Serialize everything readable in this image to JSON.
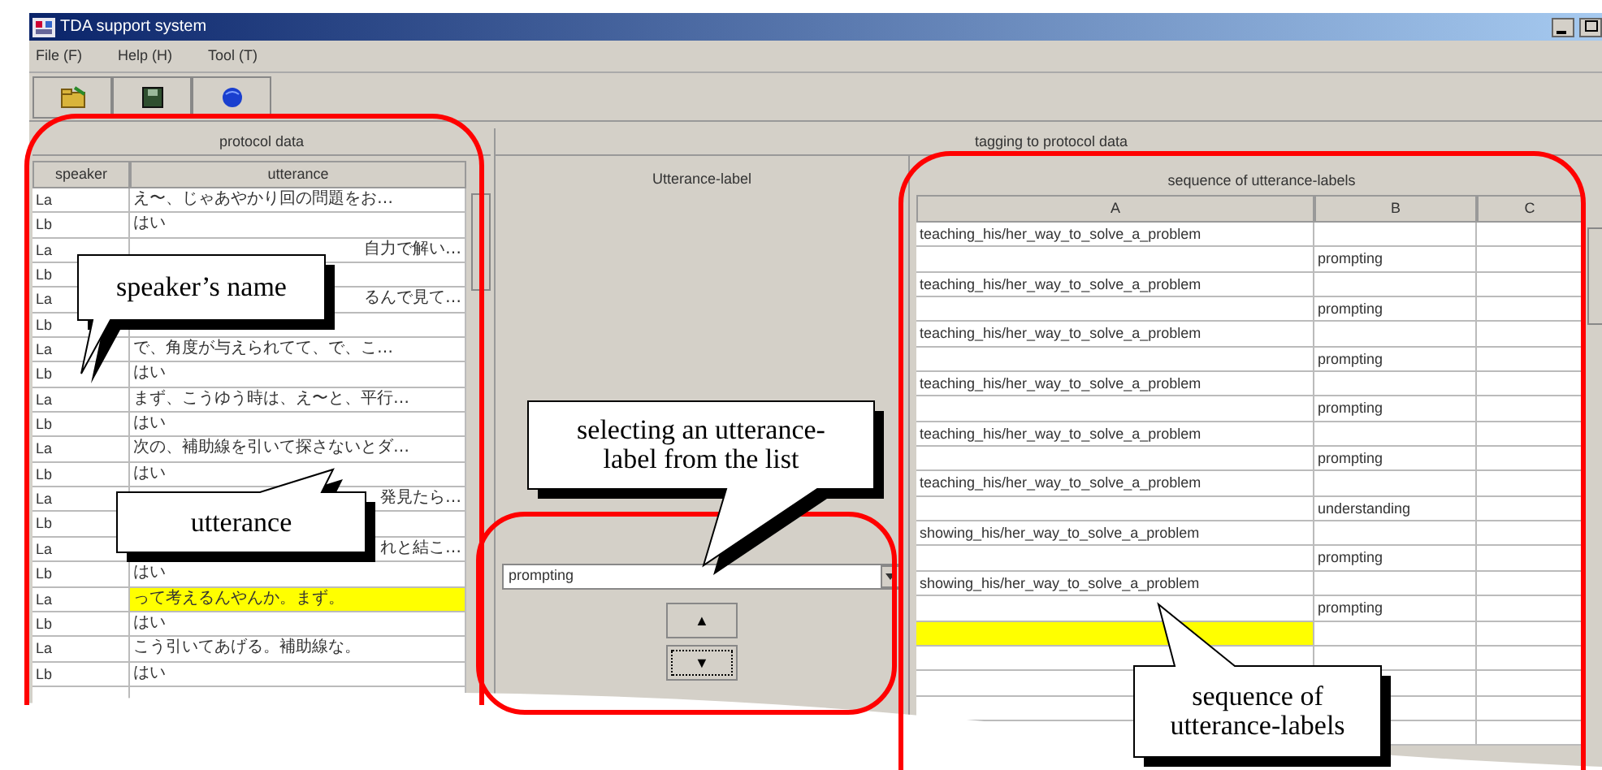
{
  "window": {
    "title": "TDA support system"
  },
  "menu": [
    "File (F)",
    "Help (H)",
    "Tool (T)"
  ],
  "toolbar": [
    {
      "kind": "open"
    },
    {
      "kind": "save"
    },
    {
      "kind": "web"
    }
  ],
  "protocol_data": {
    "title": "protocol data",
    "columns": [
      "speaker",
      "utterance"
    ],
    "rows": [
      {
        "speaker": "La",
        "utterance": "え〜、じゃあやかり回の問題をお…",
        "selected": false
      },
      {
        "speaker": "Lb",
        "utterance": "はい",
        "selected": false
      },
      {
        "speaker": "La",
        "utterance": "自力で解い…",
        "cut_left": true,
        "selected": false
      },
      {
        "speaker": "Lb",
        "selected": false
      },
      {
        "speaker": "La",
        "utterance": "るんで見て…",
        "cut_left": true,
        "selected": false
      },
      {
        "speaker": "Lb",
        "selected": false
      },
      {
        "speaker": "La",
        "utterance": "で、角度が与えられてて、で、こ…",
        "selected": false
      },
      {
        "speaker": "Lb",
        "utterance": "はい",
        "selected": false
      },
      {
        "speaker": "La",
        "utterance": "まず、こうゆう時は、え〜と、平行…",
        "selected": false
      },
      {
        "speaker": "Lb",
        "utterance": "はい",
        "selected": false
      },
      {
        "speaker": "La",
        "utterance": "次の、補助線を引いて探さないとダ…",
        "selected": false
      },
      {
        "speaker": "Lb",
        "utterance": "はい",
        "selected": false
      },
      {
        "speaker": "La",
        "utterance": "発見たら…",
        "cut_left": true,
        "selected": false
      },
      {
        "speaker": "Lb",
        "selected": false
      },
      {
        "speaker": "La",
        "utterance": "れと結こ…",
        "cut_left": true,
        "selected": false
      },
      {
        "speaker": "Lb",
        "utterance": "はい",
        "selected": false
      },
      {
        "speaker": "La",
        "utterance": "って考えるんやんか。まず。",
        "selected": true
      },
      {
        "speaker": "Lb",
        "utterance": "はい",
        "selected": false
      },
      {
        "speaker": "La",
        "utterance": "こう引いてあげる。補助線な。",
        "selected": false
      },
      {
        "speaker": "Lb",
        "utterance": "はい",
        "selected": false
      }
    ]
  },
  "tagging": {
    "title": "tagging to protocol data",
    "utterance_label": {
      "title": "Utterance-label",
      "value": "prompting",
      "buttons": [
        "▲",
        "▼"
      ]
    },
    "sequence": {
      "title": "sequence of utterance-labels",
      "columns": [
        "A",
        "B",
        "C"
      ],
      "rows": [
        {
          "a": "teaching_his/her_way_to_solve_a_problem",
          "selected": false
        },
        {
          "b": "prompting",
          "selected": false
        },
        {
          "a": "teaching_his/her_way_to_solve_a_problem",
          "selected": false
        },
        {
          "b": "prompting",
          "selected": false
        },
        {
          "a": "teaching_his/her_way_to_solve_a_problem",
          "selected": false
        },
        {
          "b": "prompting",
          "selected": false
        },
        {
          "a": "teaching_his/her_way_to_solve_a_problem",
          "selected": false
        },
        {
          "b": "prompting",
          "selected": false
        },
        {
          "a": "teaching_his/her_way_to_solve_a_problem",
          "selected": false
        },
        {
          "b": "prompting",
          "selected": false
        },
        {
          "a": "teaching_his/her_way_to_solve_a_problem",
          "selected": false
        },
        {
          "b": "understanding",
          "selected": false
        },
        {
          "a": "showing_his/her_way_to_solve_a_problem",
          "selected": false
        },
        {
          "b": "prompting",
          "selected": false
        },
        {
          "a": "showing_his/her_way_to_solve_a_problem",
          "selected": false
        },
        {
          "b": "prompting",
          "selected": false
        },
        {
          "selected": true
        }
      ]
    }
  },
  "callouts": [
    {
      "text": "speaker’s name"
    },
    {
      "text": "utterance"
    },
    {
      "text": "selecting an utterance-label from the list"
    },
    {
      "text": "sequence of utterance-labels"
    }
  ]
}
